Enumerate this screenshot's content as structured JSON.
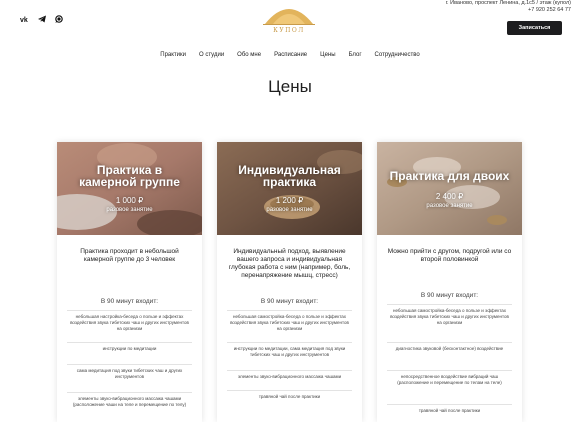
{
  "header": {
    "social": [
      "vk-icon",
      "telegram-icon",
      "whatsapp-icon"
    ],
    "logo_text": "КУПОЛ",
    "address_line1": "г. Иваново, проспект Ленина, д.1с5 / этаж (купол)",
    "phone": "+7 920 252 64 77",
    "signup_label": "Записаться"
  },
  "nav": [
    "Практики",
    "О студии",
    "Обо мне",
    "Расписание",
    "Цены",
    "Блог",
    "Сотрудничество"
  ],
  "page_title": "Цены",
  "cards": [
    {
      "title_line1": "Практика в",
      "title_line2": "камерной группе",
      "price": "1 000 ₽",
      "price_sub": "разовое занятие",
      "description": "Практика проходит в небольшой камерной группе до 3 человек",
      "includes_title": "В 90 минут входит:",
      "items": [
        "небольшая настройка-беседа о пользе и эффектах воздействия звука тибетских чаш и других инструментов на организм",
        "инструкции по медитации",
        "сама медитация под звуки тибетских чаш и других инструментов",
        "элементы звуко-вибрационного массажа чашами (расположение чаши на теле и перемещение по телу)"
      ]
    },
    {
      "title_line1": "Индивидуальная",
      "title_line2": "практика",
      "price": "1 200 ₽",
      "price_sub": "разовое занятие",
      "description": "Индивидуальный подход, выявление вашего запроса и индивидуальная глубокая работа с ним (например, боль, перенапряжение мышц, стресс)",
      "includes_title": "В 90 минут входит:",
      "items": [
        "небольшая самостройка-беседа о пользе и эффектах воздействия звука тибетских чаш и других инструментов на организм",
        "инструкции по медитации, сама медитация под звуки тибетских чаш и других инструментов",
        "элементы звуко-вибрационного массажа чашами",
        "травяной чай после практики"
      ]
    },
    {
      "title_line1": "Практика для двоих",
      "title_line2": "",
      "price": "2 400 ₽",
      "price_sub": "разовое занятие",
      "description": "Можно прийти с другом, подругой или со второй половинкой",
      "includes_title": "В 90 минут входит:",
      "items": [
        "небольшая самостройка-беседа о пользе и эффектах воздействия звука тибетских чаш и других инструментов на организм",
        "диагностика звуковой (бесконтактное) воздействие",
        "непосредственное воздействие вибраций чаш (расположение и перемещение по телам на теле)",
        "травяной чай после практики"
      ]
    }
  ]
}
